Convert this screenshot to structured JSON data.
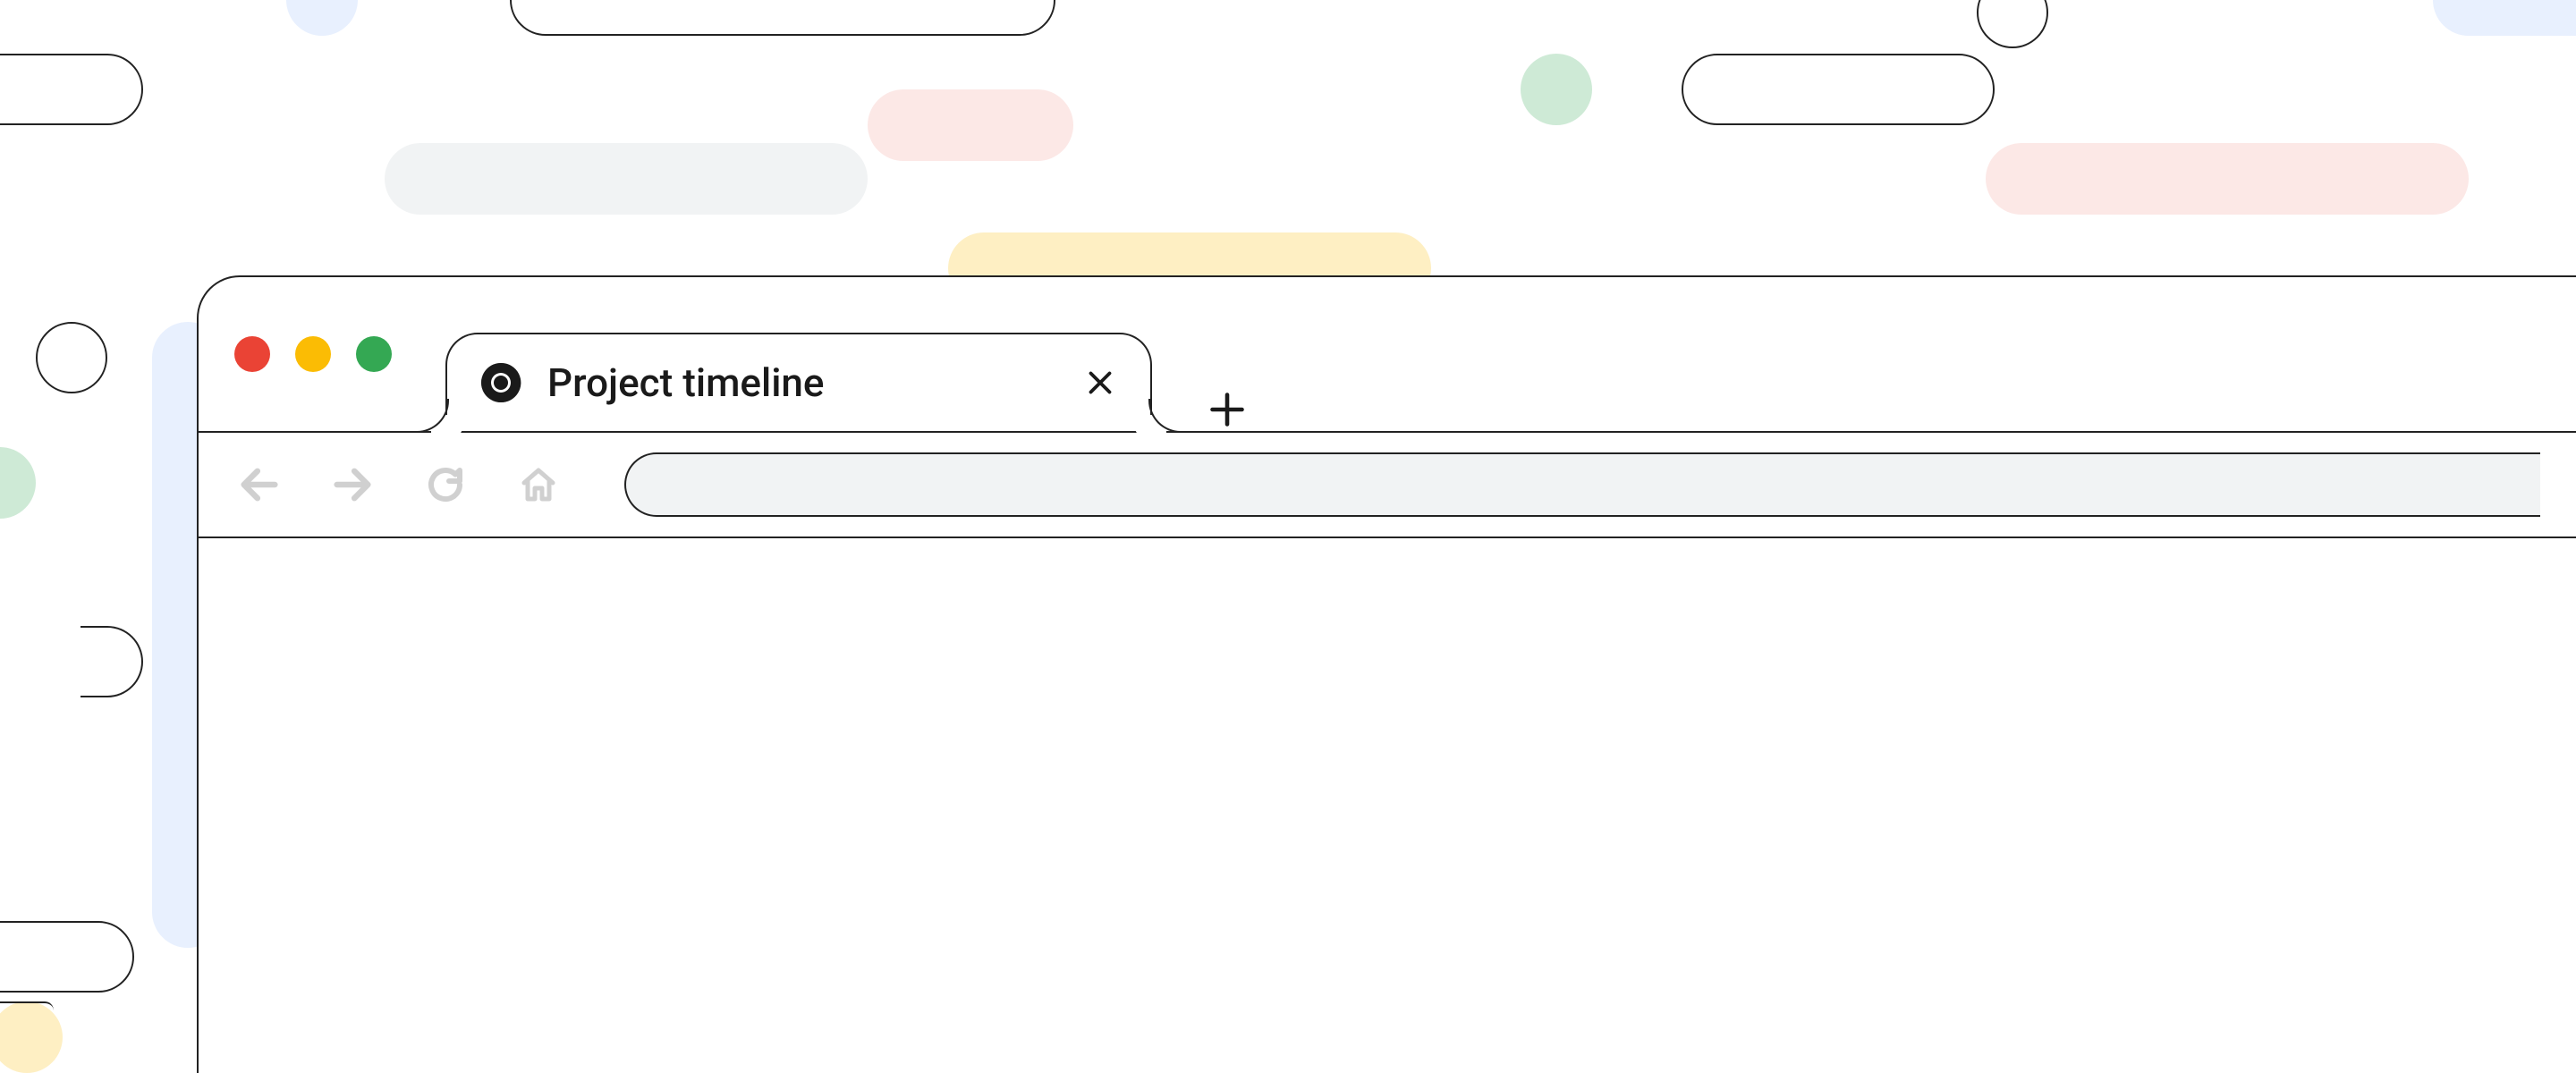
{
  "browser": {
    "tabs": [
      {
        "title": "Project timeline",
        "favicon": "chrome"
      }
    ],
    "address_bar": {
      "value": ""
    }
  },
  "colors": {
    "red": "#EA4335",
    "yellow": "#FBBC04",
    "green": "#34A853",
    "blue_light": "#e8f0fe",
    "green_light": "#ceead6",
    "yellow_light": "#feefc3",
    "pink_light": "#fce8e6",
    "gray_light": "#f1f3f4"
  }
}
